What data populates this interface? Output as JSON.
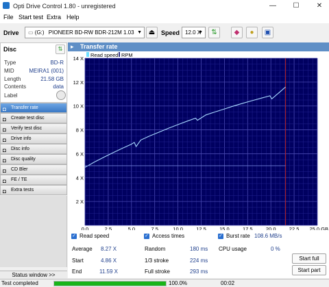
{
  "window": {
    "title": "Opti Drive Control 1.80 - unregistered",
    "minimize": "—",
    "maximize": "☐",
    "close": "✕"
  },
  "menu": [
    "File",
    "Start test",
    "Extra",
    "Help"
  ],
  "toolbar": {
    "drive_label": "Drive",
    "drive_letter": "(G:)",
    "drive_name": "PIONEER BD-RW   BDR-212M 1.03",
    "speed_label": "Speed",
    "speed_value": "12.0 X"
  },
  "disc": {
    "header": "Disc",
    "rows": [
      {
        "label": "Type",
        "value": "BD-R"
      },
      {
        "label": "MID",
        "value": "MEIRA1 (001)"
      },
      {
        "label": "Length",
        "value": "21.58 GB"
      },
      {
        "label": "Contents",
        "value": "data"
      },
      {
        "label": "Label",
        "value": ""
      }
    ]
  },
  "nav": [
    {
      "label": "Transfer rate",
      "icon": "transfer-rate-icon",
      "active": true
    },
    {
      "label": "Create test disc",
      "icon": "create-disc-icon",
      "active": false
    },
    {
      "label": "Verify test disc",
      "icon": "verify-disc-icon",
      "active": false
    },
    {
      "label": "Drive info",
      "icon": "drive-info-icon",
      "active": false
    },
    {
      "label": "Disc info",
      "icon": "disc-info-icon",
      "active": false
    },
    {
      "label": "Disc quality",
      "icon": "disc-quality-icon",
      "active": false
    },
    {
      "label": "CD Bler",
      "icon": "cd-bler-icon",
      "active": false
    },
    {
      "label": "FE / TE",
      "icon": "fe-te-icon",
      "active": false
    },
    {
      "label": "Extra tests",
      "icon": "extra-tests-icon",
      "active": false
    }
  ],
  "status_window_button": "Status window >>",
  "chart_panel_title": "Transfer rate",
  "chart_data": {
    "type": "line",
    "title": "",
    "xlabel": "",
    "ylabel": "",
    "xlim": [
      0,
      25
    ],
    "ylim": [
      0,
      14
    ],
    "x_unit": "GB",
    "y_unit": "X",
    "x_ticks": [
      "0.0",
      "2.5",
      "5.0",
      "7.5",
      "10.0",
      "12.5",
      "15.0",
      "17.5",
      "20.0",
      "22.5",
      "25.0 GB"
    ],
    "y_ticks": [
      "2 X",
      "4 X",
      "6 X",
      "8 X",
      "10 X",
      "12 X",
      "14 X"
    ],
    "legend": [
      "Read speed",
      "RPM"
    ],
    "legend_placement": "top-left",
    "grid": true,
    "disc_end": 21.58,
    "series": [
      {
        "name": "Read speed",
        "x": [
          0.0,
          1.0,
          2.0,
          3.0,
          4.0,
          5.0,
          5.3,
          5.5,
          6.0,
          7.0,
          8.0,
          9.0,
          10.0,
          11.0,
          11.9,
          12.1,
          13.0,
          14.0,
          15.0,
          16.0,
          17.0,
          18.0,
          19.0,
          19.9,
          20.1,
          21.0,
          21.58
        ],
        "y": [
          4.86,
          5.3,
          5.7,
          6.08,
          6.45,
          6.8,
          6.95,
          6.6,
          7.15,
          7.5,
          7.82,
          8.14,
          8.44,
          8.73,
          8.98,
          8.8,
          9.25,
          9.5,
          9.75,
          10.0,
          10.23,
          10.45,
          10.66,
          10.85,
          10.6,
          11.2,
          11.59
        ]
      },
      {
        "name": "RPM",
        "x": [
          0.0,
          5.0,
          10.0,
          15.0,
          20.0,
          21.58
        ],
        "y": [
          5.0,
          5.0,
          5.0,
          5.0,
          5.0,
          5.0
        ]
      }
    ]
  },
  "stats": {
    "read_speed_label": "Read speed",
    "access_times_label": "Access times",
    "burst_rate_label": "Burst rate",
    "burst_rate_value": "108.6 MB/s",
    "average_label": "Average",
    "average_value": "8.27 X",
    "start_label": "Start",
    "start_value": "4.86 X",
    "end_label": "End",
    "end_value": "11.59 X",
    "random_label": "Random",
    "random_value": "180 ms",
    "one_third_label": "1/3 stroke",
    "one_third_value": "224 ms",
    "full_label": "Full stroke",
    "full_value": "293 ms",
    "cpu_label": "CPU usage",
    "cpu_value": "0 %",
    "start_full_button": "Start full",
    "start_part_button": "Start part"
  },
  "statusbar": {
    "text": "Test completed",
    "progress_percent": 100,
    "progress_text": "100.0%",
    "elapsed": "00:02"
  }
}
